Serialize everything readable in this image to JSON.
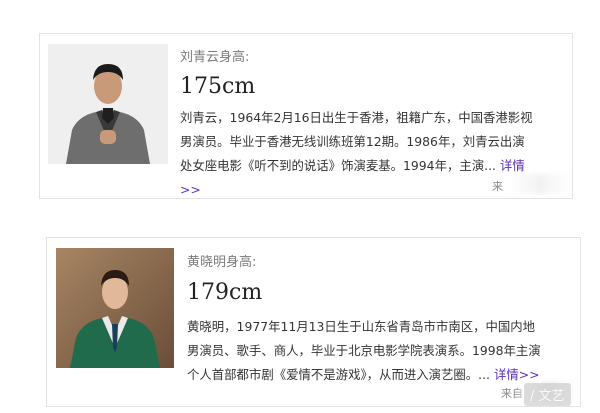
{
  "cards": [
    {
      "name_label": "刘青云身高:",
      "height_value": "175cm",
      "description": "刘青云，1964年2月16日出生于香港，祖籍广东，中国香港影视男演员。毕业于香港无线训练班第12期。1986年，刘青云出演处女座电影《听不到的说话》饰演麦基。1994年，主演...",
      "more_link": "详情>>",
      "source_label": "来",
      "photo_desc": "man-in-grey-suit"
    },
    {
      "name_label": "黄晓明身高:",
      "height_value": "179cm",
      "description": "黄晓明，1977年11月13日生于山东省青岛市市南区，中国内地男演员、歌手、商人，毕业于北京电影学院表演系。1998年主演个人首部都市剧《爱情不是游戏》，从而进入演艺圈。...",
      "more_link": "详情>>",
      "source_label": "来自",
      "photo_desc": "man-in-green-suit"
    }
  ],
  "watermark": "/ 文艺",
  "colors": {
    "link": "#5b2eb4",
    "name": "#7a7a7a",
    "border": "#e3e3e3"
  }
}
